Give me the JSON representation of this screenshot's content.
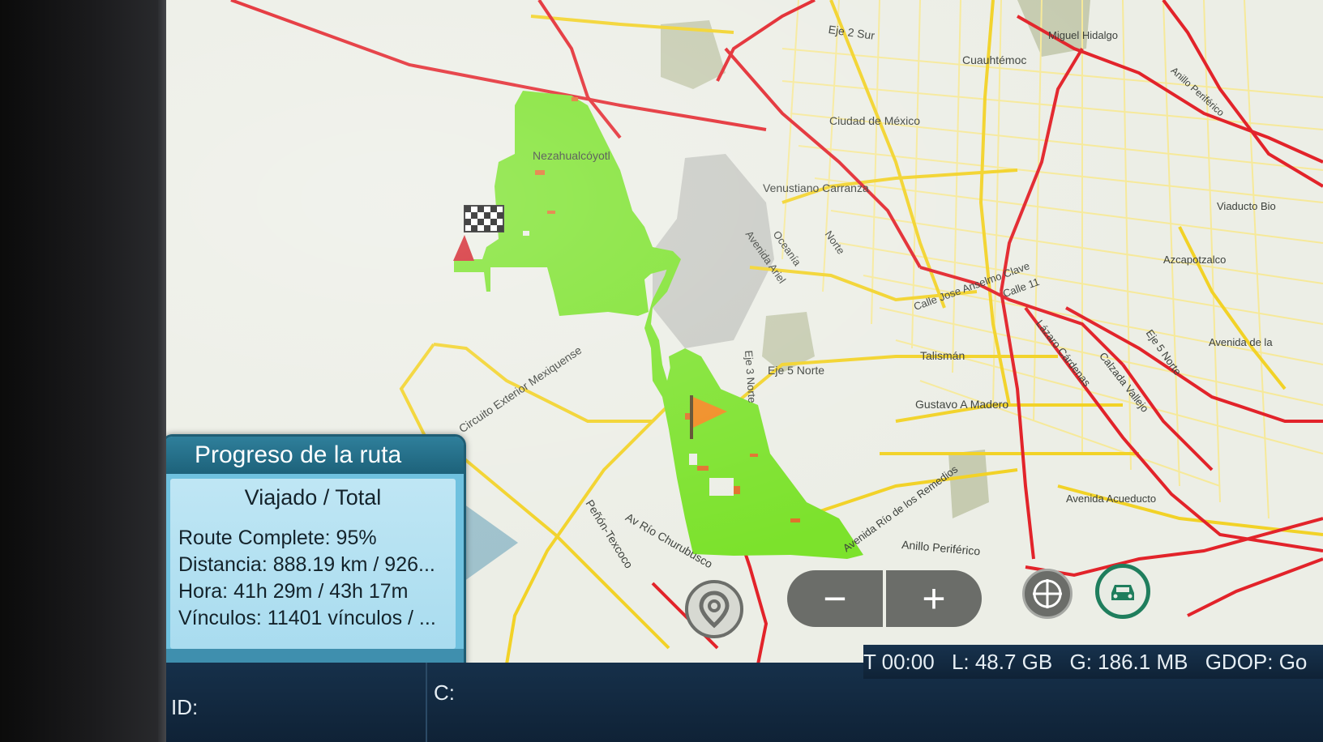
{
  "map": {
    "labels": {
      "nezahualcoyotl": "Nezahualcóyotl",
      "eje2sur": "Eje 2 Sur",
      "miguel_hidalgo": "Miguel Hidalgo",
      "cuauhtemoc": "Cuauhtémoc",
      "anillo_periferico_ne": "Anillo Periférico",
      "ciudad_de_mexico": "Ciudad de México",
      "venustiano_carranza": "Venustiano Carranza",
      "viaducto": "Viaducto Bio",
      "azcapotzalco": "Azcapotzalco",
      "oceania": "Oceanía",
      "avenida_ariel": "Avenida Ariel",
      "norte": "Norte",
      "calle_jose": "Calle Jose Anselmo Clave",
      "calle_11": "Calle 11",
      "avenida_de_la": "Avenida de la",
      "eje5_norte_right": "Eje 5 Norte",
      "lazaro_cardenas": "Lázaro Cárdenas",
      "calzada_vallejo": "Calzada Vallejo",
      "talisman": "Talismán",
      "eje5_norte": "Eje 5 Norte",
      "eje3_norte": "Eje 3 Norte",
      "gustavo_madero": "Gustavo A Madero",
      "circuito_exterior": "Circuito Exterior Mexiquense",
      "avenida_rio_remedios": "Avenida Río de los Remedios",
      "avenida_acueducto": "Avenida Acueducto",
      "anillo_periferico": "Anillo Periférico",
      "av_rio_churubusco": "Av Río Churubusco",
      "penon_texcoco": "Peñón-Texcoco"
    },
    "colors": {
      "background": "#eceee6",
      "route": "#7ce22c",
      "primary_road": "#e2232a",
      "secondary_road": "#f2d227",
      "minor_road": "#f6e99a",
      "park": "#c6cbb0",
      "water_area": "#c8cac4"
    }
  },
  "route_panel": {
    "title": "Progreso de la ruta",
    "subtitle": "Viajado / Total",
    "route_complete": "Route Complete: 95%",
    "distance": "Distancia: 888.19 km / 926...",
    "time": "Hora: 41h 29m / 43h 17m",
    "links": "Vínculos: 11401 vínculos / ..."
  },
  "controls": {
    "location_icon": "location-pin-icon",
    "zoom_out_label": "−",
    "zoom_in_label": "+",
    "compass_icon": "crosshair-icon",
    "vehicle_icon": "car-follow-icon"
  },
  "status_bar": {
    "time": "T 00:00",
    "storage": "L:  48.7 GB",
    "memory": "G: 186.1 MB",
    "gdop": "GDOP: Go",
    "id_label": "ID:",
    "c_label": "C:"
  }
}
